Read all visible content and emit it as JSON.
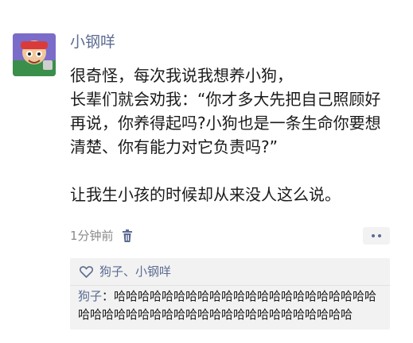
{
  "post": {
    "username": "小钢咩",
    "text": "很奇怪，每次我说我想养小狗，\n长辈们就会劝我：“你才多大先把自己照顾好再说，你养得起吗?小狗也是一条生命你要想清楚、你有能力对它负责吗?”\n\n让我生小孩的时候却从来没人这么说。",
    "time": "1分钟前",
    "icons": {
      "delete": "trash-icon",
      "more": "more-dots-icon",
      "like": "heart-icon"
    }
  },
  "likes": {
    "names": "狗子、小钢咩"
  },
  "comments": [
    {
      "author": "狗子",
      "separator": "：",
      "text": "哈哈哈哈哈哈哈哈哈哈哈哈哈哈哈哈哈哈哈哈哈哈哈哈哈哈哈哈哈哈哈哈哈哈哈哈哈哈哈哈哈哈哈哈哈"
    }
  ],
  "colors": {
    "link": "#5b6b92",
    "comment_bg": "#f2f2f2",
    "meta": "#8a8a8a"
  }
}
